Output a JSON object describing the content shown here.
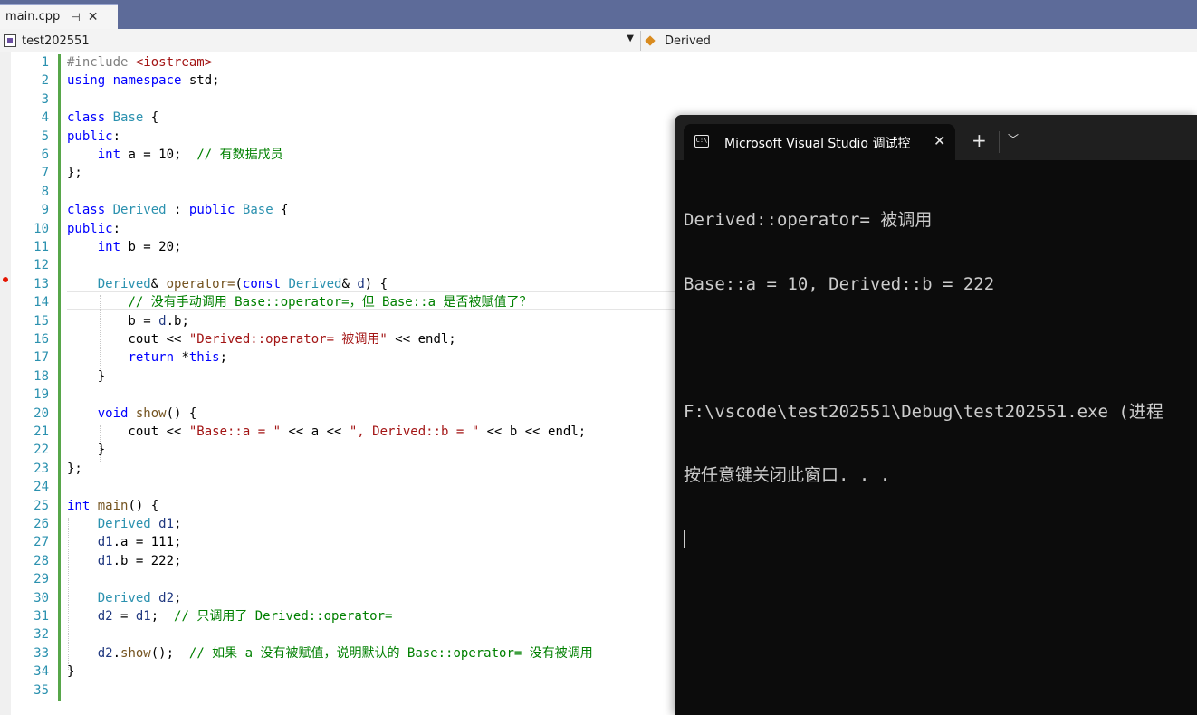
{
  "tab": {
    "file_name": "main.cpp",
    "pin_glyph": "⊣",
    "close_glyph": "✕"
  },
  "nav": {
    "project": "test202551",
    "scope": "Derived"
  },
  "editor": {
    "lines": [
      {
        "n": "1",
        "html": "<span class=\"pp\">#include</span> <span class=\"inc\">&lt;iostream&gt;</span>"
      },
      {
        "n": "2",
        "html": "<span class=\"kw\">using</span> <span class=\"kw\">namespace</span> std;"
      },
      {
        "n": "3",
        "html": ""
      },
      {
        "n": "4",
        "html": "<span class=\"kw\">class</span> <span class=\"ty\">Base</span> {"
      },
      {
        "n": "5",
        "html": "<span class=\"kw\">public</span>:"
      },
      {
        "n": "6",
        "html": "    <span class=\"kw\">int</span> a = 10;  <span class=\"cm\">// 有数据成员</span>"
      },
      {
        "n": "7",
        "html": "};"
      },
      {
        "n": "8",
        "html": ""
      },
      {
        "n": "9",
        "html": "<span class=\"kw\">class</span> <span class=\"ty\">Derived</span> : <span class=\"kw\">public</span> <span class=\"ty\">Base</span> {"
      },
      {
        "n": "10",
        "html": "<span class=\"kw\">public</span>:"
      },
      {
        "n": "11",
        "html": "    <span class=\"kw\">int</span> b = 20;"
      },
      {
        "n": "12",
        "html": ""
      },
      {
        "n": "13",
        "html": "    <span class=\"ty\">Derived</span>&amp; <span class=\"fn\">operator=</span>(<span class=\"kw\">const</span> <span class=\"ty\">Derived</span>&amp; <span class=\"vr\">d</span>) {"
      },
      {
        "n": "14",
        "html": "        <span class=\"cm\">// 没有手动调用 Base::operator=，但 Base::a 是否被赋值了？</span>"
      },
      {
        "n": "15",
        "html": "        b = <span class=\"vr\">d</span>.b;"
      },
      {
        "n": "16",
        "html": "        cout &lt;&lt; <span class=\"str\">\"Derived::operator= 被调用\"</span> &lt;&lt; endl;"
      },
      {
        "n": "17",
        "html": "        <span class=\"kw\">return</span> *<span class=\"kw\">this</span>;"
      },
      {
        "n": "18",
        "html": "    }"
      },
      {
        "n": "19",
        "html": ""
      },
      {
        "n": "20",
        "html": "    <span class=\"kw\">void</span> <span class=\"fn\">show</span>() {"
      },
      {
        "n": "21",
        "html": "        cout &lt;&lt; <span class=\"str\">\"Base::a = \"</span> &lt;&lt; a &lt;&lt; <span class=\"str\">\", Derived::b = \"</span> &lt;&lt; b &lt;&lt; endl;"
      },
      {
        "n": "22",
        "html": "    }"
      },
      {
        "n": "23",
        "html": "};"
      },
      {
        "n": "24",
        "html": ""
      },
      {
        "n": "25",
        "html": "<span class=\"kw\">int</span> <span class=\"fn\">main</span>() {"
      },
      {
        "n": "26",
        "html": "    <span class=\"ty\">Derived</span> <span class=\"vr\">d1</span>;"
      },
      {
        "n": "27",
        "html": "    <span class=\"vr\">d1</span>.a = 111;"
      },
      {
        "n": "28",
        "html": "    <span class=\"vr\">d1</span>.b = 222;"
      },
      {
        "n": "29",
        "html": ""
      },
      {
        "n": "30",
        "html": "    <span class=\"ty\">Derived</span> <span class=\"vr\">d2</span>;"
      },
      {
        "n": "31",
        "html": "    <span class=\"vr\">d2</span> = <span class=\"vr\">d1</span>;  <span class=\"cm\">// 只调用了 Derived::operator=</span>"
      },
      {
        "n": "32",
        "html": ""
      },
      {
        "n": "33",
        "html": "    <span class=\"vr\">d2</span>.<span class=\"fn\">show</span>();  <span class=\"cm\">// 如果 a 没有被赋值，说明默认的 Base::operator= 没有被调用</span>"
      },
      {
        "n": "34",
        "html": "}"
      },
      {
        "n": "35",
        "html": ""
      }
    ]
  },
  "terminal": {
    "title": "Microsoft Visual Studio 调试控",
    "icon_text": "C:\\",
    "close_glyph": "✕",
    "new_tab_glyph": "+",
    "dropdown_glyph": "⌄",
    "output": [
      "Derived::operator= 被调用",
      "Base::a = 10, Derived::b = 222",
      "",
      "F:\\vscode\\test202551\\Debug\\test202551.exe (进程",
      "按任意键关闭此窗口. . ."
    ]
  }
}
